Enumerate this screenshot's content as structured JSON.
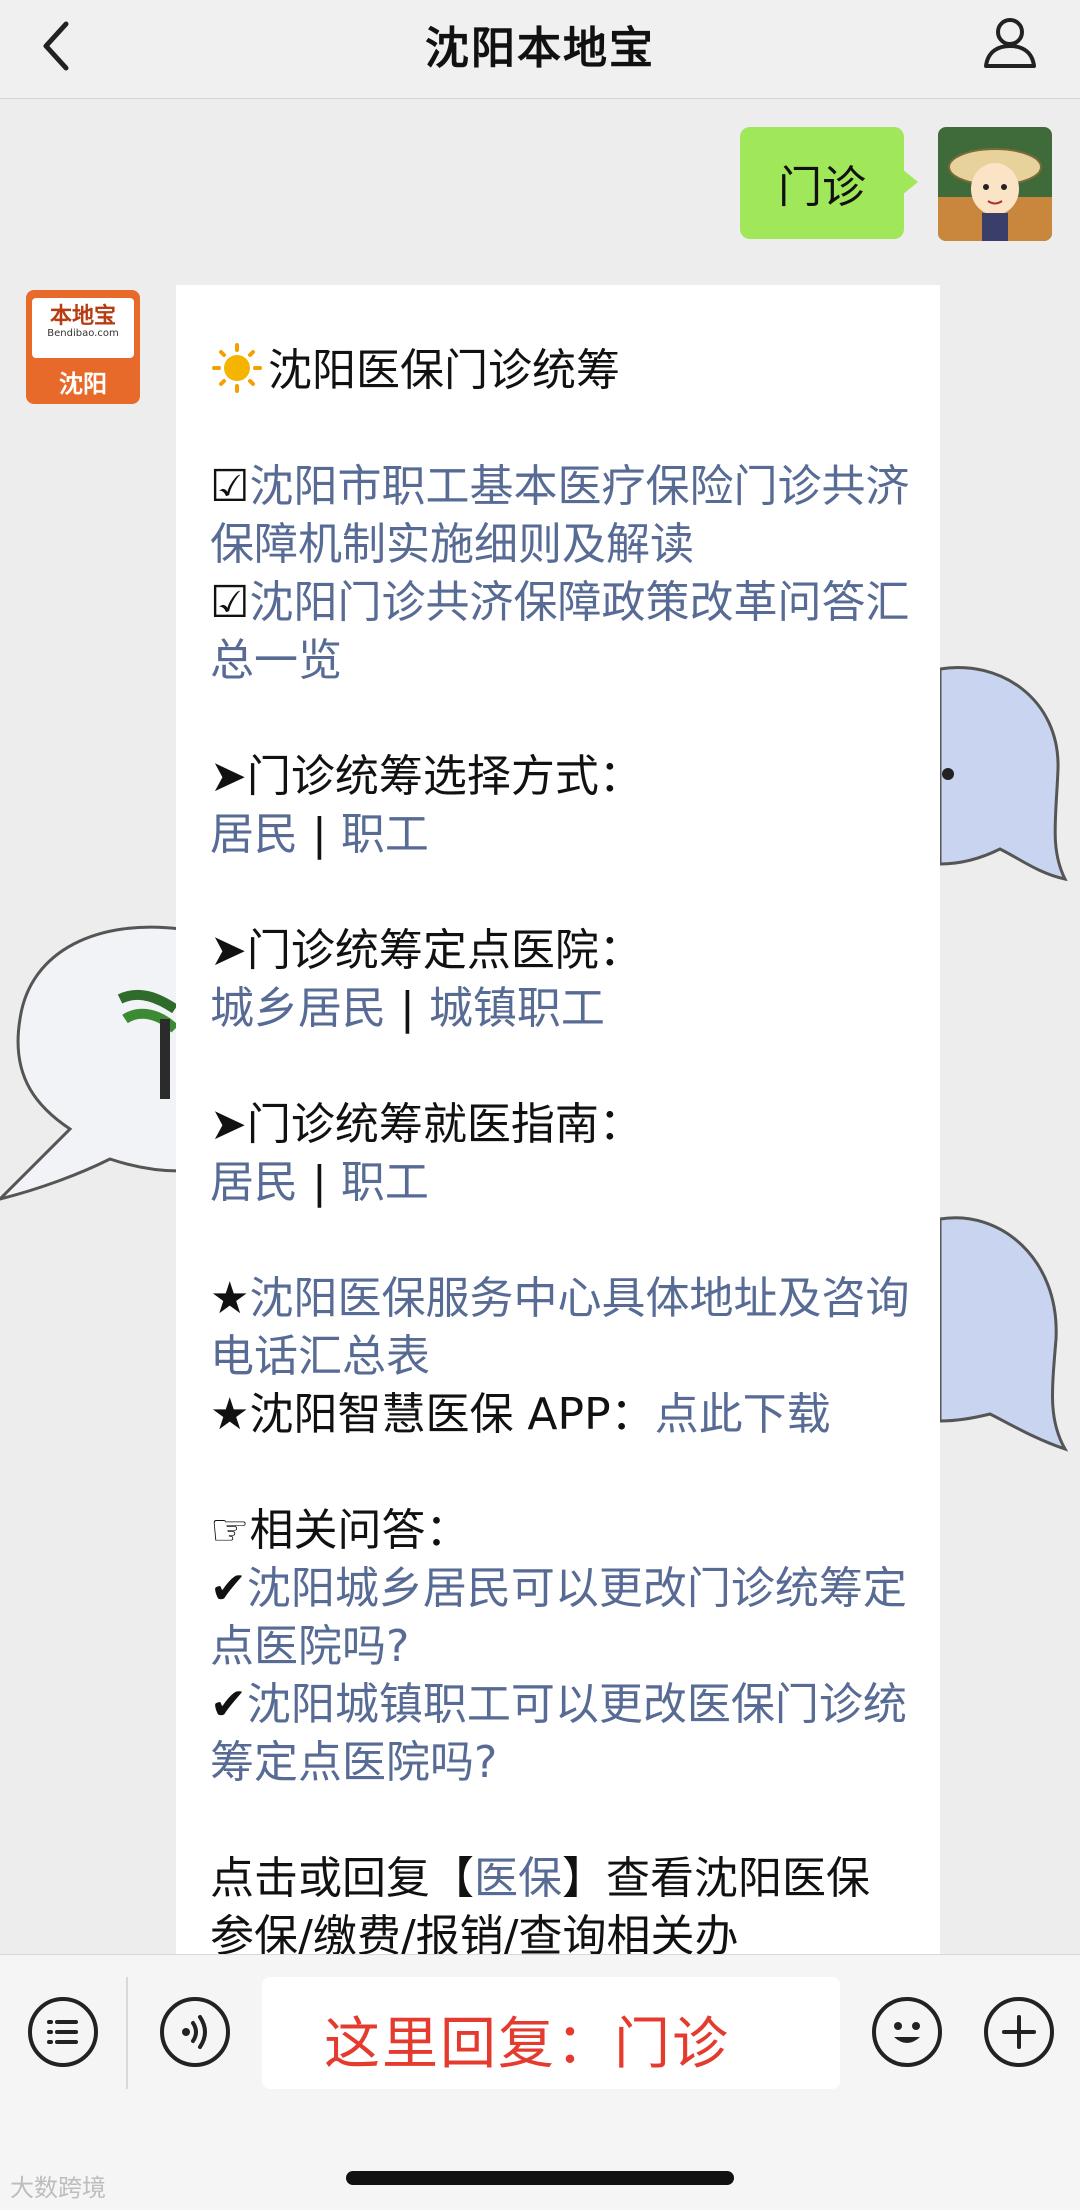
{
  "header": {
    "title": "沈阳本地宝"
  },
  "messages": {
    "outgoing_text": "门诊",
    "bot_avatar": {
      "brand": "本地宝",
      "sub": "Bendibao.com",
      "city": "沈阳"
    },
    "article": {
      "heading": "沈阳医保门诊统筹",
      "link1": "沈阳市职工基本医疗保险门诊共济保障机制实施细则及解读",
      "link2": "沈阳门诊共济保障政策改革问答汇总一览",
      "section1_title": "➤门诊统筹选择方式：",
      "section1_a": "居民",
      "section1_b": "职工",
      "section2_title": "➤门诊统筹定点医院：",
      "section2_a": "城乡居民",
      "section2_b": "城镇职工",
      "section3_title": "➤门诊统筹就医指南：",
      "section3_a": "居民",
      "section3_b": "职工",
      "star1_link": "沈阳医保服务中心具体地址及咨询电话汇总表",
      "star2_prefix": "★沈阳智慧医保 APP：",
      "star2_link": "点此下载",
      "qa_title": "相关问答：",
      "qa1": "沈阳城乡居民可以更改门诊统筹定点医院吗?",
      "qa2": "沈阳城镇职工可以更改医保门诊统筹定点医院吗?",
      "footer_prefix": "点击或回复【",
      "footer_link": "医保",
      "footer_suffix": "】查看沈阳医保参保/缴费/报销/查询相关办"
    }
  },
  "input": {
    "text": "这里回复：门诊"
  },
  "watermark": "大数跨境"
}
